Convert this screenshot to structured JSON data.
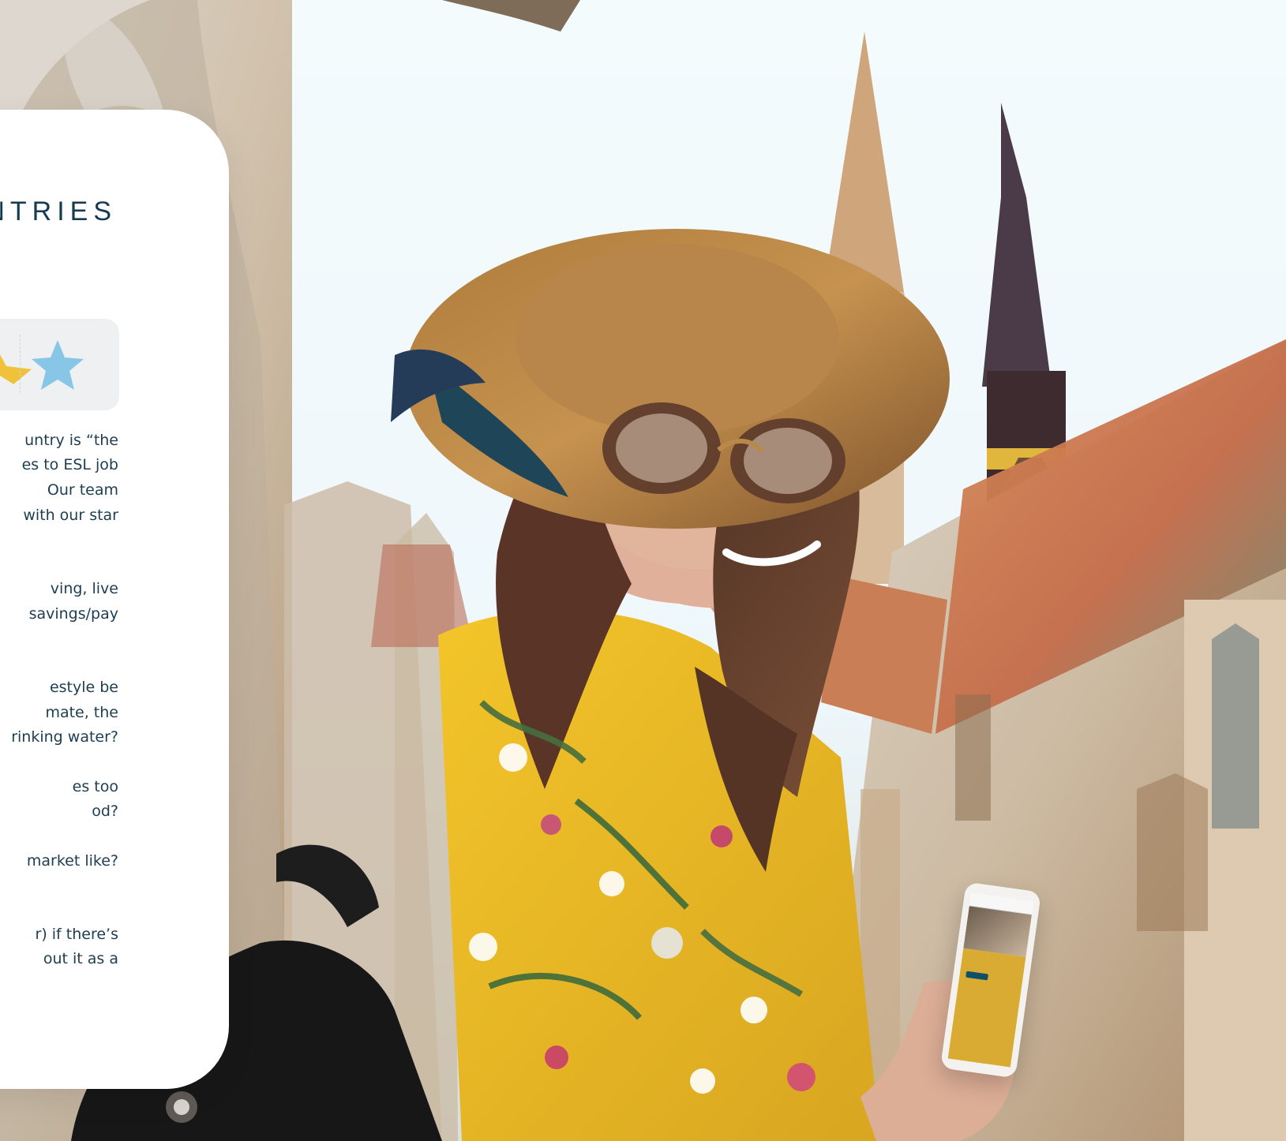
{
  "panel": {
    "heading": "NTRIES",
    "lines": [
      "untry is “the",
      "es to ESL job",
      "Our team",
      "with our star",
      "ving, live",
      "savings/pay",
      "estyle be",
      "mate, the",
      "rinking water?",
      "es too",
      "od?",
      "market like?",
      "r) if there’s",
      "out it as a"
    ]
  },
  "icons": {
    "gold_star": "star-icon",
    "blue_star": "star-icon"
  },
  "colors": {
    "heading": "#163a4f",
    "body_text": "#1d3d52",
    "gold_star": "#f0c23a",
    "blue_star": "#87c6e6",
    "rating_bg": "#eef0f2",
    "dress_yellow": "#e5b425",
    "sky": "#eef7fb"
  }
}
